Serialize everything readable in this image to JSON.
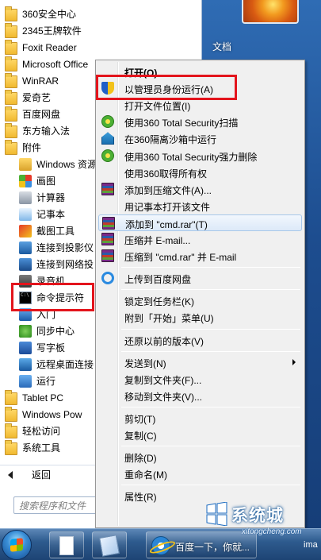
{
  "programs": [
    {
      "label": "360安全中心",
      "icon": "folder-icon"
    },
    {
      "label": "2345王牌软件",
      "icon": "folder-icon"
    },
    {
      "label": "Foxit Reader",
      "icon": "folder-icon"
    },
    {
      "label": "Microsoft Office",
      "icon": "folder-icon"
    },
    {
      "label": "WinRAR",
      "icon": "folder-icon"
    },
    {
      "label": "爱奇艺",
      "icon": "folder-icon"
    },
    {
      "label": "百度网盘",
      "icon": "folder-icon"
    },
    {
      "label": "东方输入法",
      "icon": "folder-icon"
    },
    {
      "label": "附件",
      "icon": "folder-icon"
    },
    {
      "label": "Windows 资源",
      "icon": "explorer-icon"
    },
    {
      "label": "画图",
      "icon": "paint-icon"
    },
    {
      "label": "计算器",
      "icon": "calculator-icon"
    },
    {
      "label": "记事本",
      "icon": "notepad-icon"
    },
    {
      "label": "截图工具",
      "icon": "snipping-icon"
    },
    {
      "label": "连接到投影仪",
      "icon": "projector-icon"
    },
    {
      "label": "连接到网络投",
      "icon": "network-projector-icon"
    },
    {
      "label": "录音机",
      "icon": "recorder-icon"
    },
    {
      "label": "命令提示符",
      "icon": "cmd-icon"
    },
    {
      "label": "入门",
      "icon": "getting-started-icon"
    },
    {
      "label": "同步中心",
      "icon": "sync-icon"
    },
    {
      "label": "写字板",
      "icon": "wordpad-icon"
    },
    {
      "label": "远程桌面连接",
      "icon": "remote-desktop-icon"
    },
    {
      "label": "运行",
      "icon": "run-icon"
    },
    {
      "label": "Tablet PC",
      "icon": "folder-icon"
    },
    {
      "label": "Windows Pow",
      "icon": "folder-icon"
    },
    {
      "label": "轻松访问",
      "icon": "folder-icon"
    },
    {
      "label": "系统工具",
      "icon": "folder-icon"
    }
  ],
  "back_label": "返回",
  "search_placeholder": "搜索程序和文件",
  "right_pane": {
    "documents_label": "文档"
  },
  "context_menu": {
    "items": [
      {
        "label": "打开(O)",
        "bold": true,
        "icon": ""
      },
      {
        "label": "以管理员身份运行(A)",
        "icon": "uac-shield-icon",
        "highlighted": true
      },
      {
        "label": "打开文件位置(I)",
        "icon": ""
      },
      {
        "label": "使用360 Total Security扫描",
        "icon": "360-security-icon"
      },
      {
        "label": "在360隔离沙箱中运行",
        "icon": "360-sandbox-icon"
      },
      {
        "label": "使用360 Total Security强力删除",
        "icon": "360-security-icon"
      },
      {
        "label": "使用360取得所有权",
        "icon": ""
      },
      {
        "label": "添加到压缩文件(A)...",
        "icon": "winrar-icon"
      },
      {
        "label": "用记事本打开该文件",
        "icon": ""
      },
      {
        "label": "添加到 \"cmd.rar\"(T)",
        "icon": "winrar-icon",
        "hover": true
      },
      {
        "label": "压缩并 E-mail...",
        "icon": "winrar-icon"
      },
      {
        "label": "压缩到 \"cmd.rar\" 并 E-mail",
        "icon": "winrar-icon"
      },
      {
        "separator": true
      },
      {
        "label": "上传到百度网盘",
        "icon": "baidu-netdisk-icon"
      },
      {
        "separator": true
      },
      {
        "label": "锁定到任务栏(K)",
        "icon": ""
      },
      {
        "label": "附到「开始」菜单(U)",
        "icon": ""
      },
      {
        "separator": true
      },
      {
        "label": "还原以前的版本(V)",
        "icon": ""
      },
      {
        "separator": true
      },
      {
        "label": "发送到(N)",
        "icon": "",
        "submenu": true
      },
      {
        "label": "复制到文件夹(F)...",
        "icon": ""
      },
      {
        "label": "移动到文件夹(V)...",
        "icon": ""
      },
      {
        "separator": true
      },
      {
        "label": "剪切(T)",
        "icon": ""
      },
      {
        "label": "复制(C)",
        "icon": ""
      },
      {
        "separator": true
      },
      {
        "label": "删除(D)",
        "icon": ""
      },
      {
        "label": "重命名(M)",
        "icon": ""
      },
      {
        "separator": true
      },
      {
        "label": "属性(R)",
        "icon": ""
      }
    ]
  },
  "taskbar": {
    "ie_label": "百度一下，你就...",
    "tray_text": "ima"
  },
  "watermark": {
    "brand": "系统城",
    "url": "xitongcheng.com"
  },
  "colors": {
    "highlight_box": "#e3141c",
    "menu_hover": "#dce9f8",
    "taskbar": "#2e5b8e"
  }
}
